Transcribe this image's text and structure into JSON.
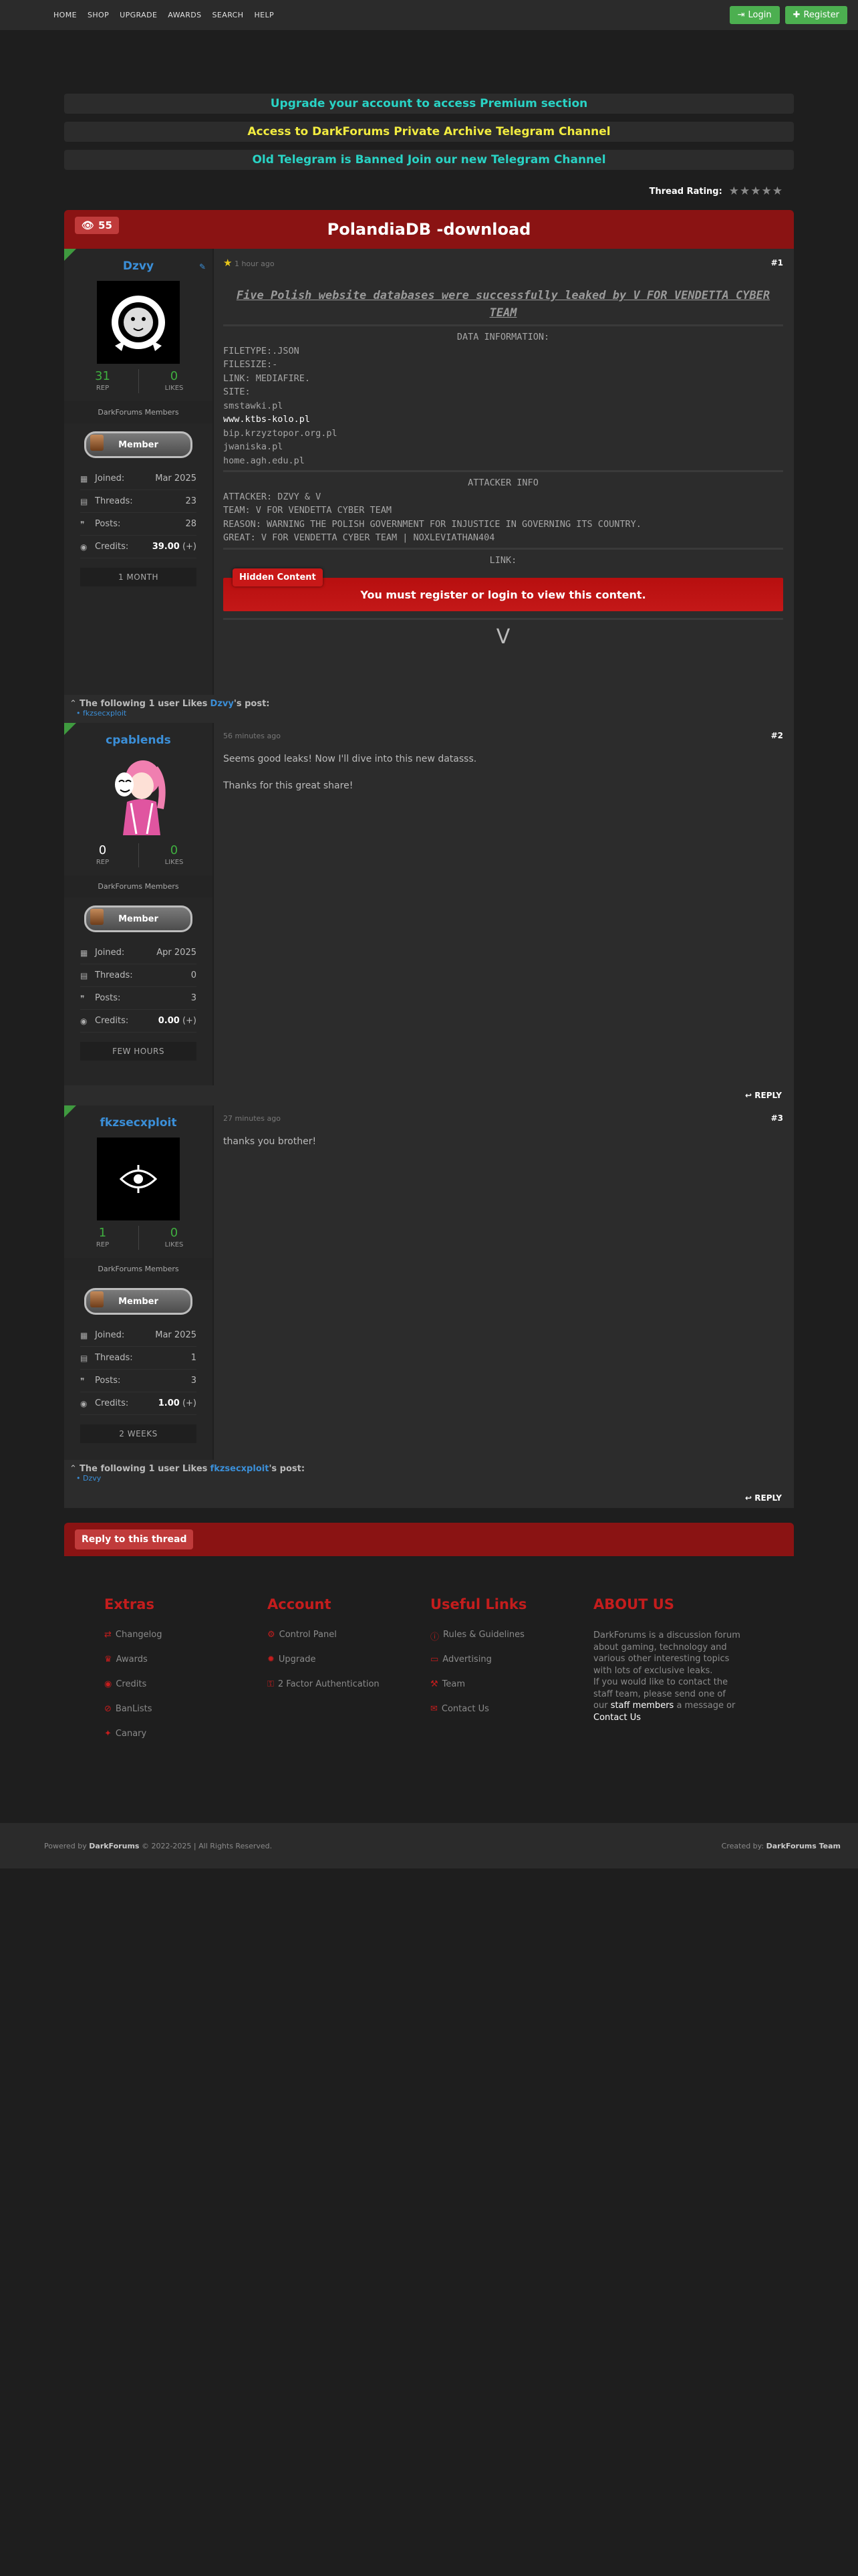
{
  "nav": {
    "items": [
      "HOME",
      "SHOP",
      "UPGRADE",
      "AWARDS",
      "SEARCH",
      "HELP"
    ],
    "login": "Login",
    "register": "Register"
  },
  "notices": [
    "Upgrade your account to access Premium section",
    "Access to DarkForums Private Archive Telegram Channel",
    "Old Telegram is Banned Join our new Telegram Channel"
  ],
  "rating": {
    "label": "Thread Rating:",
    "stars": 5,
    "value": 0
  },
  "thread": {
    "title": "PolandiaDB -download",
    "views": "55"
  },
  "posts": [
    {
      "username": "Dzvy",
      "rep": "31",
      "likes": "0",
      "group": "DarkForums Members",
      "badge": "Member",
      "joined_label": "Joined:",
      "joined": "Mar 2025",
      "threads_label": "Threads:",
      "threads": "23",
      "posts_label": "Posts:",
      "posts": "28",
      "credits_label": "Credits:",
      "credits": "39.00",
      "credits_suffix": "(+)",
      "membership": "1 MONTH",
      "time": "1 hour ago",
      "number": "#1",
      "intro": "Five Polish website databases were successfully leaked by V FOR VENDETTA CYBER TEAM",
      "data_heading": "DATA INFORMATION:",
      "data_lines": [
        "FILETYPE:.JSON",
        "FILESIZE:-",
        "LINK: MEDIAFIRE.",
        "SITE:",
        "smstawki.pl",
        "www.ktbs-kolo.pl",
        "bip.krzyztopor.org.pl",
        "jwaniska.pl",
        "home.agh.edu.pl"
      ],
      "attacker_heading": "ATTACKER INFO",
      "attacker_lines": [
        "ATTACKER: DZVY & V",
        "TEAM: V FOR VENDETTA CYBER TEAM",
        "REASON: WARNING THE POLISH GOVERNMENT FOR INJUSTICE IN GOVERNING ITS COUNTRY.",
        "GREAT: V FOR VENDETTA CYBER TEAM | NOXLEVIATHAN404"
      ],
      "link_heading": "LINK:",
      "hidden_tag": "Hidden Content",
      "hidden_text": "You must register or login to view this content.",
      "signature": "V",
      "likes_prefix": "The following 1 user Likes",
      "likes_user": "Dzvy",
      "likes_suffix": "'s post:",
      "liker": "• fkzsecxploit"
    },
    {
      "username": "cpablends",
      "rep": "0",
      "likes": "0",
      "group": "DarkForums Members",
      "badge": "Member",
      "joined_label": "Joined:",
      "joined": "Apr 2025",
      "threads_label": "Threads:",
      "threads": "0",
      "posts_label": "Posts:",
      "posts": "3",
      "credits_label": "Credits:",
      "credits": "0.00",
      "credits_suffix": "(+)",
      "membership": "FEW HOURS",
      "time": "56 minutes ago",
      "number": "#2",
      "body1": "Seems good leaks! Now I'll dive into this new datasss.",
      "body2": "Thanks for this great share!",
      "reply": "REPLY"
    },
    {
      "username": "fkzsecxploit",
      "rep": "1",
      "likes": "0",
      "group": "DarkForums Members",
      "badge": "Member",
      "joined_label": "Joined:",
      "joined": "Mar 2025",
      "threads_label": "Threads:",
      "threads": "1",
      "posts_label": "Posts:",
      "posts": "3",
      "credits_label": "Credits:",
      "credits": "1.00",
      "credits_suffix": "(+)",
      "membership": "2 WEEKS",
      "time": "27 minutes ago",
      "number": "#3",
      "body1": "thanks you brother!",
      "likes_prefix": "The following 1 user Likes",
      "likes_user": "fkzsecxploit",
      "likes_suffix": "'s post:",
      "liker": "• Dzvy",
      "reply": "REPLY"
    }
  ],
  "reply_thread": "Reply to this thread",
  "footer": {
    "extras": {
      "title": "Extras",
      "links": [
        "Changelog",
        "Awards",
        "Credits",
        "BanLists",
        "Canary"
      ]
    },
    "account": {
      "title": "Account",
      "links": [
        "Control Panel",
        "Upgrade",
        "2 Factor Authentication"
      ]
    },
    "useful": {
      "title": "Useful Links",
      "links": [
        "Rules & Guidelines",
        "Advertising",
        "Team",
        "Contact Us"
      ]
    },
    "about": {
      "title": "ABOUT US",
      "text1": "DarkForums is a discussion forum about gaming, technology and various other interesting topics with lots of exclusive leaks.",
      "text2": "If you would like to contact the staff team, please send one of our",
      "staff": "staff members",
      "text3": "a message or",
      "contact": "Contact Us"
    },
    "powered_prefix": "Powered by",
    "powered_brand": "DarkForums",
    "powered_suffix": "© 2022-2025 | All Rights Reserved.",
    "created_prefix": "Created by:",
    "created_brand": "DarkForums Team"
  },
  "colors": {
    "accent_red": "#8a1313",
    "cyan": "#29d3c5",
    "yellow": "#f2ec40",
    "green": "#4caf50",
    "link_blue": "#3b8fd8"
  }
}
